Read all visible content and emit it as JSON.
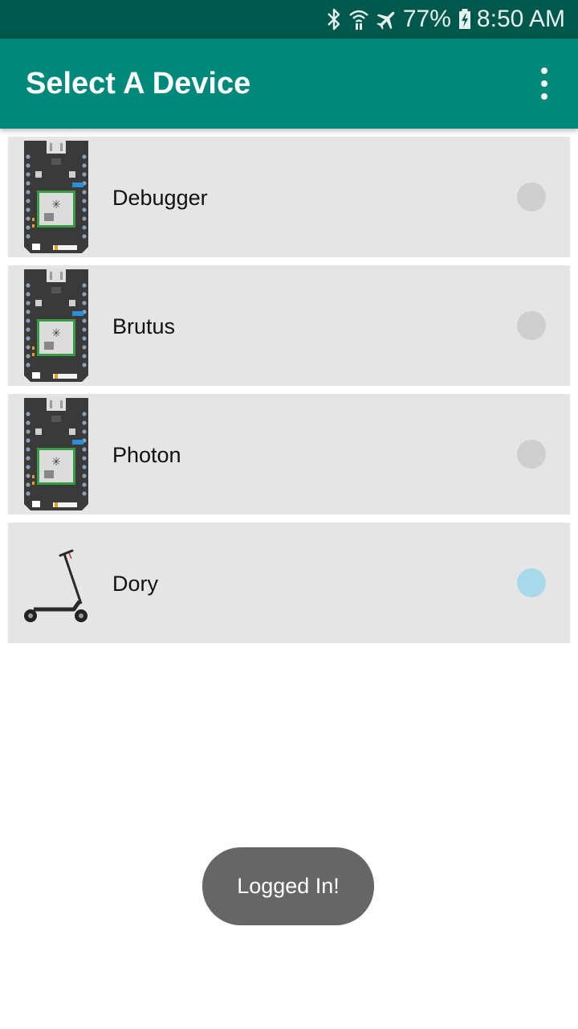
{
  "status_bar": {
    "battery_percent": "77%",
    "time": "8:50 AM",
    "icons": [
      "bluetooth-icon",
      "wifi-icon",
      "airplane-mode-icon",
      "battery-charging-icon"
    ]
  },
  "app_bar": {
    "title": "Select A Device",
    "menu_icon": "overflow-menu-icon"
  },
  "devices": [
    {
      "name": "Debugger",
      "thumbnail": "photon-board",
      "selected": false
    },
    {
      "name": "Brutus",
      "thumbnail": "photon-board",
      "selected": false
    },
    {
      "name": "Photon",
      "thumbnail": "photon-board",
      "selected": false
    },
    {
      "name": "Dory",
      "thumbnail": "scooter",
      "selected": true
    }
  ],
  "toast": {
    "message": "Logged In!"
  },
  "colors": {
    "status_bar": "#00574B",
    "app_bar": "#00897B",
    "list_item_bg": "#E5E5E5",
    "radio_unselected": "#CFCFCF",
    "radio_selected": "#A7D9EA",
    "toast_bg": "#666666"
  }
}
